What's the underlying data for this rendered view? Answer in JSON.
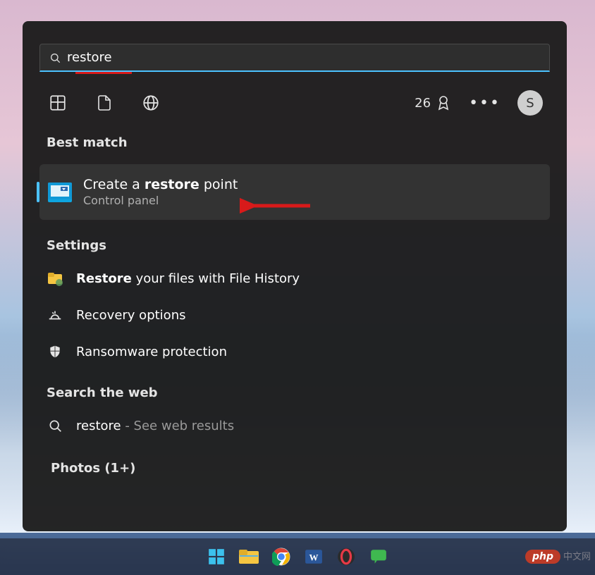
{
  "search": {
    "value": "restore"
  },
  "rewards": {
    "points": "26"
  },
  "avatar": {
    "initial": "S"
  },
  "sections": {
    "best_match_header": "Best match",
    "settings_header": "Settings",
    "web_header": "Search the web",
    "photos_header": "Photos (1+)"
  },
  "best_match": {
    "title_pre": "Create a ",
    "title_bold": "restore",
    "title_post": " point",
    "subtitle": "Control panel"
  },
  "settings_results": [
    {
      "icon": "folder",
      "pre": "",
      "bold": "Restore",
      "post": " your files with File History"
    },
    {
      "icon": "recovery",
      "pre": "",
      "bold": "",
      "post": "Recovery options"
    },
    {
      "icon": "shield",
      "pre": "",
      "bold": "",
      "post": "Ransomware protection"
    }
  ],
  "web_result": {
    "term": "restore",
    "suffix": " - See web results"
  },
  "taskbar": [
    {
      "name": "start"
    },
    {
      "name": "explorer"
    },
    {
      "name": "chrome"
    },
    {
      "name": "word"
    },
    {
      "name": "opera"
    },
    {
      "name": "messaging"
    }
  ],
  "watermark": {
    "badge": "php",
    "text": "中文网"
  }
}
